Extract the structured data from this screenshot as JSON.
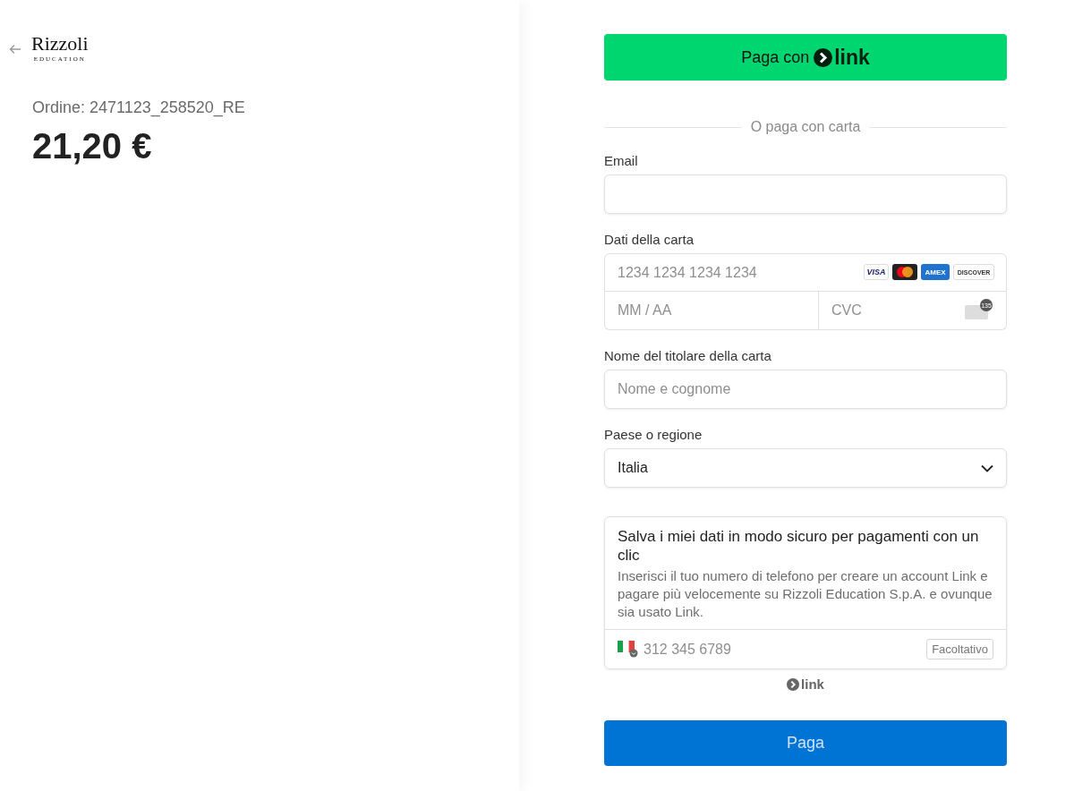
{
  "brand": {
    "name": "Rizzoli",
    "subtitle": "EDUCATION"
  },
  "order": {
    "label": "Ordine: 2471123_258520_RE",
    "amount": "21,20 €"
  },
  "link_button": {
    "label": "Paga con",
    "logo": "link"
  },
  "divider": "O paga con carta",
  "email": {
    "label": "Email"
  },
  "card": {
    "label": "Dati della carta",
    "number_placeholder": "1234 1234 1234 1234",
    "expiry_placeholder": "MM / AA",
    "cvc_placeholder": "CVC",
    "cvc_badge": "135",
    "brands": [
      {
        "kind": "visa",
        "label": "VISA"
      },
      {
        "kind": "mastercard"
      },
      {
        "kind": "amex",
        "label": "AMEX"
      },
      {
        "kind": "discover",
        "label": "DISCOVER"
      }
    ]
  },
  "holder": {
    "label": "Nome del titolare della carta",
    "placeholder": "Nome e cognome"
  },
  "country": {
    "label": "Paese o regione",
    "value": "Italia"
  },
  "save": {
    "title": "Salva i miei dati in modo sicuro per pagamenti con un clic",
    "text": "Inserisci il tuo numero di telefono per creare un account Link e pagare più velocemente su Rizzoli Education S.p.A. e ovunque sia usato Link.",
    "phone_placeholder": "312 345 6789",
    "optional": "Facoltativo"
  },
  "link_footer": "link",
  "pay_button": "Paga"
}
